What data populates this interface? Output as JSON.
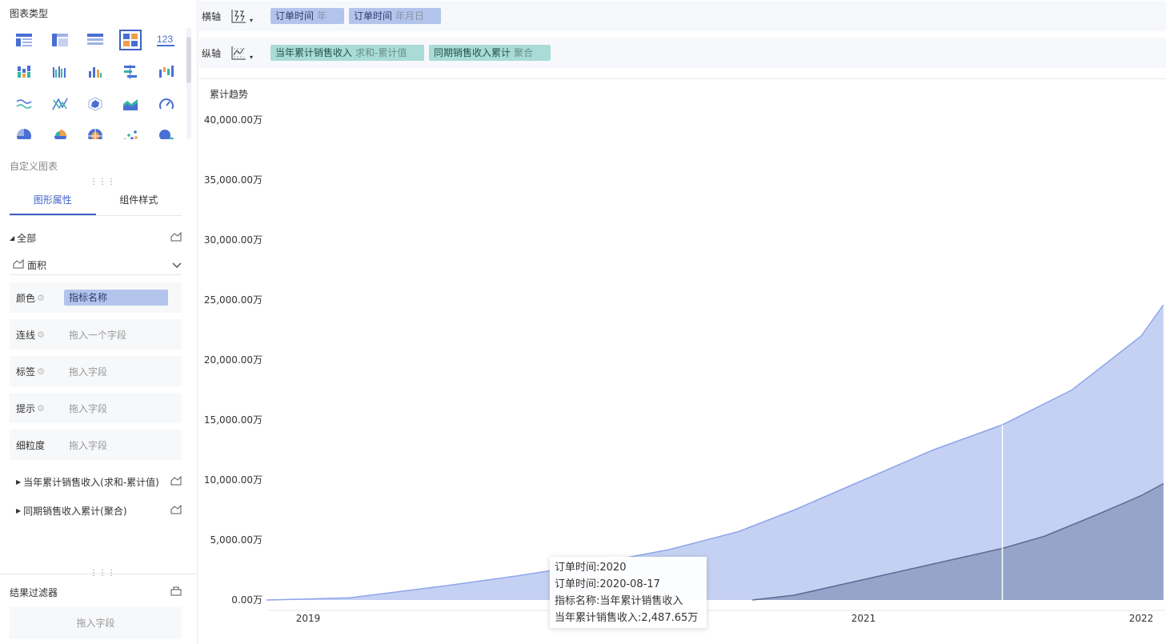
{
  "left": {
    "chart_type_title": "图表类型",
    "custom_chart": "自定义图表",
    "tabs": [
      {
        "label": "图形属性"
      },
      {
        "label": "组件样式"
      }
    ],
    "all_label": "全部",
    "mark_type": "面积",
    "props": [
      {
        "label": "颜色",
        "value": "指标名称"
      },
      {
        "label": "连线",
        "placeholder": "拖入一个字段"
      },
      {
        "label": "标签",
        "placeholder": "拖入字段"
      },
      {
        "label": "提示",
        "placeholder": "拖入字段"
      },
      {
        "label": "细粒度",
        "placeholder": "拖入字段"
      }
    ],
    "series": [
      {
        "label": "当年累计销售收入(求和-累计值)"
      },
      {
        "label": "同期销售收入累计(聚合)"
      }
    ],
    "filter_title": "结果过滤器",
    "filter_placeholder": "拖入字段"
  },
  "x_axis": {
    "label": "横轴",
    "fields": [
      {
        "name": "订单时间",
        "agg": "年"
      },
      {
        "name": "订单时间",
        "agg": "年月日"
      }
    ]
  },
  "y_axis": {
    "label": "纵轴",
    "fields": [
      {
        "name": "当年累计销售收入",
        "agg": "求和-累计值"
      },
      {
        "name": "同期销售收入累计",
        "agg": "聚合"
      }
    ]
  },
  "chart_data": {
    "type": "area",
    "title": "累计趋势",
    "y_ticks": [
      "40,000.00万",
      "35,000.00万",
      "30,000.00万",
      "25,000.00万",
      "20,000.00万",
      "15,000.00万",
      "10,000.00万",
      "5,000.00万",
      "0.00万"
    ],
    "ylim": [
      0,
      40000
    ],
    "x_ticks": [
      "2019",
      "2020",
      "2021",
      "2022"
    ],
    "grid": false,
    "series": [
      {
        "name": "当年累计销售收入",
        "color": "#c5d1f3",
        "line_color": "#8ea5ea",
        "points": [
          [
            2018.85,
            0
          ],
          [
            2019.0,
            80
          ],
          [
            2019.15,
            180
          ],
          [
            2019.5,
            1200
          ],
          [
            2019.75,
            2000
          ],
          [
            2020.0,
            2900
          ],
          [
            2020.3,
            4200
          ],
          [
            2020.55,
            5700
          ],
          [
            2020.75,
            7500
          ],
          [
            2021.0,
            10000
          ],
          [
            2021.25,
            12500
          ],
          [
            2021.5,
            14600
          ],
          [
            2021.75,
            17500
          ],
          [
            2022.0,
            22000
          ],
          [
            2022.08,
            24600
          ]
        ]
      },
      {
        "name": "同期销售收入累计",
        "color": "#96a4c9",
        "line_color": "#5d6b95",
        "points": [
          [
            2020.6,
            0
          ],
          [
            2020.75,
            400
          ],
          [
            2021.0,
            1700
          ],
          [
            2021.25,
            3000
          ],
          [
            2021.5,
            4300
          ],
          [
            2021.65,
            5300
          ],
          [
            2021.85,
            7200
          ],
          [
            2022.0,
            8700
          ],
          [
            2022.08,
            9700
          ]
        ]
      }
    ],
    "crosshair_x": 2021.5
  },
  "tooltip": {
    "line1": "订单时间:2020",
    "line2": "订单时间:2020-08-17",
    "line3": "指标名称:当年累计销售收入",
    "line4": "当年累计销售收入:2,487.65万"
  },
  "icons": {
    "accent": "#3e63c4",
    "icon_blue": "#4a6fd3",
    "icon_orange": "#f0a04b",
    "icon_teal": "#35b5a4"
  }
}
